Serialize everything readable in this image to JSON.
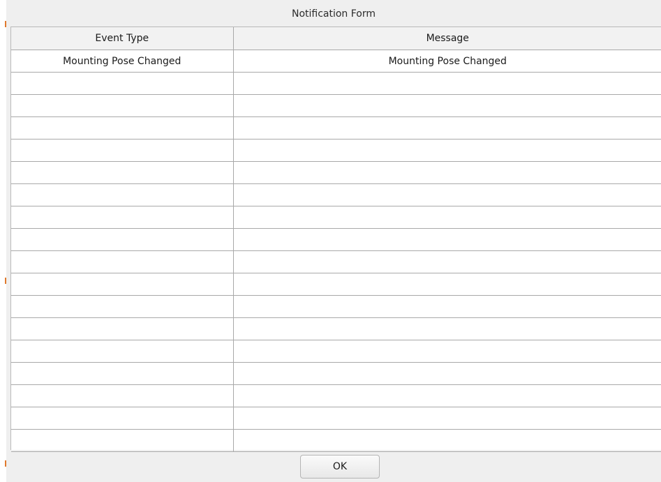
{
  "dialog": {
    "title": "Notification Form"
  },
  "table": {
    "columns": [
      "Event Type",
      "Message"
    ],
    "rows": [
      [
        "Mounting Pose Changed",
        "Mounting Pose Changed"
      ],
      [
        "",
        ""
      ],
      [
        "",
        ""
      ],
      [
        "",
        ""
      ],
      [
        "",
        ""
      ],
      [
        "",
        ""
      ],
      [
        "",
        ""
      ],
      [
        "",
        ""
      ],
      [
        "",
        ""
      ],
      [
        "",
        ""
      ],
      [
        "",
        ""
      ],
      [
        "",
        ""
      ],
      [
        "",
        ""
      ],
      [
        "",
        ""
      ],
      [
        "",
        ""
      ],
      [
        "",
        ""
      ],
      [
        "",
        ""
      ],
      [
        "",
        ""
      ]
    ]
  },
  "footer": {
    "ok_label": "OK"
  },
  "colors": {
    "dialog_background": "#efefef",
    "grid_line": "#a9a9a9",
    "edge_accent": "#e07a2e"
  }
}
